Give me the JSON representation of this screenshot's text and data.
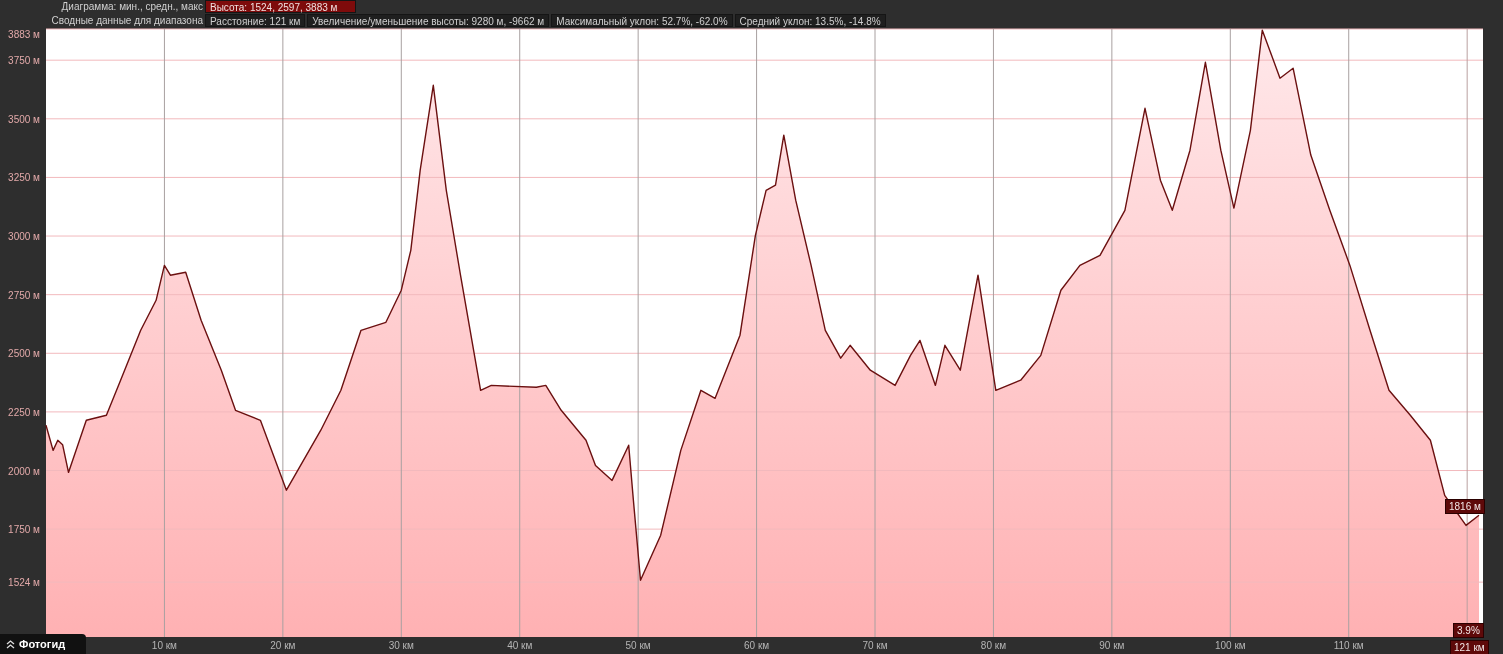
{
  "header": {
    "chart_label": "Диаграмма: мин., средн., макс",
    "chart_value": "Высота: 1524, 2597, 3883 м",
    "summary_label": "Сводные данные для диапазона",
    "summary": [
      "Расстояние: 121 км",
      "Увеличение/уменьшение высоты: 9280 м, -9662 м",
      "Максимальный уклон: 52.7%, -62.0%",
      "Средний уклон: 13.5%, -14.8%"
    ]
  },
  "chart_data": {
    "type": "area",
    "grid": true,
    "ref_lines": [
      {
        "axis": "x",
        "value": 120
      }
    ],
    "xlim": [
      0,
      121
    ],
    "ylim": [
      1290,
      3883
    ],
    "xticks": [
      {
        "value": 10,
        "label": "10 км"
      },
      {
        "value": 20,
        "label": "20 км"
      },
      {
        "value": 30,
        "label": "30 км"
      },
      {
        "value": 40,
        "label": "40 км"
      },
      {
        "value": 50,
        "label": "50 км"
      },
      {
        "value": 60,
        "label": "60 км"
      },
      {
        "value": 70,
        "label": "70 км"
      },
      {
        "value": 80,
        "label": "80 км"
      },
      {
        "value": 90,
        "label": "90 км"
      },
      {
        "value": 100,
        "label": "100 км"
      },
      {
        "value": 110,
        "label": "110 км"
      }
    ],
    "yticks": [
      {
        "value": 1524,
        "label": "1524 м"
      },
      {
        "value": 1750,
        "label": "1750 м"
      },
      {
        "value": 2000,
        "label": "2000 м"
      },
      {
        "value": 2250,
        "label": "2250 м"
      },
      {
        "value": 2500,
        "label": "2500 м"
      },
      {
        "value": 2750,
        "label": "2750 м"
      },
      {
        "value": 3000,
        "label": "3000 м"
      },
      {
        "value": 3250,
        "label": "3250 м"
      },
      {
        "value": 3500,
        "label": "3500 м"
      },
      {
        "value": 3750,
        "label": "3750 м"
      },
      {
        "value": 3883,
        "label": "3883 м"
      }
    ],
    "x": [
      0,
      0.6,
      1,
      1.4,
      1.9,
      3.4,
      5.1,
      6.3,
      8,
      9.3,
      10,
      10.5,
      11.8,
      13.1,
      14.8,
      16,
      18.1,
      20.3,
      21.5,
      23.2,
      24.9,
      26.6,
      28.7,
      30,
      30.8,
      31.6,
      32.7,
      33.8,
      35,
      36.7,
      37.6,
      41.4,
      42.2,
      43.5,
      45.6,
      46.4,
      47.8,
      49.2,
      49.6,
      50.2,
      51.9,
      53.6,
      55.3,
      56.5,
      58.6,
      59.9,
      60.8,
      61.6,
      62.3,
      63.3,
      64.6,
      65.8,
      67.1,
      67.9,
      69.6,
      71.7,
      73,
      73.8,
      75.1,
      75.9,
      77.2,
      78.7,
      80.2,
      82.3,
      84,
      85.7,
      87.3,
      89,
      91.1,
      92.8,
      94.1,
      95.1,
      96.6,
      97.9,
      99.2,
      100.3,
      101.7,
      102.7,
      104.2,
      105.3,
      106.8,
      108.4,
      110.1,
      111.8,
      113.4,
      115.2,
      116.9,
      118.1,
      119.9,
      121
    ],
    "series": [
      {
        "color": "#6b1010",
        "values": [
          2193,
          2086,
          2129,
          2110,
          1992,
          2214,
          2236,
          2385,
          2598,
          2726,
          2875,
          2833,
          2846,
          2641,
          2428,
          2257,
          2214,
          1916,
          2022,
          2172,
          2342,
          2598,
          2632,
          2769,
          2939,
          3281,
          3643,
          3195,
          2833,
          2342,
          2363,
          2355,
          2363,
          2257,
          2129,
          2022,
          1958,
          2108,
          1873,
          1532,
          1724,
          2086,
          2342,
          2308,
          2577,
          3003,
          3195,
          3217,
          3430,
          3153,
          2875,
          2598,
          2479,
          2534,
          2428,
          2363,
          2491,
          2555,
          2363,
          2534,
          2428,
          2833,
          2342,
          2385,
          2491,
          2769,
          2875,
          2918,
          3110,
          3545,
          3238,
          3110,
          3366,
          3741,
          3366,
          3119,
          3451,
          3878,
          3673,
          3716,
          3345,
          3110,
          2875,
          2598,
          2342,
          2236,
          2129,
          1894,
          1766,
          1809
        ]
      }
    ]
  },
  "cursor": {
    "elevation": "1816 м",
    "grade": "3.9%",
    "distance": "121 км"
  },
  "photo_guide": "Фотогид"
}
